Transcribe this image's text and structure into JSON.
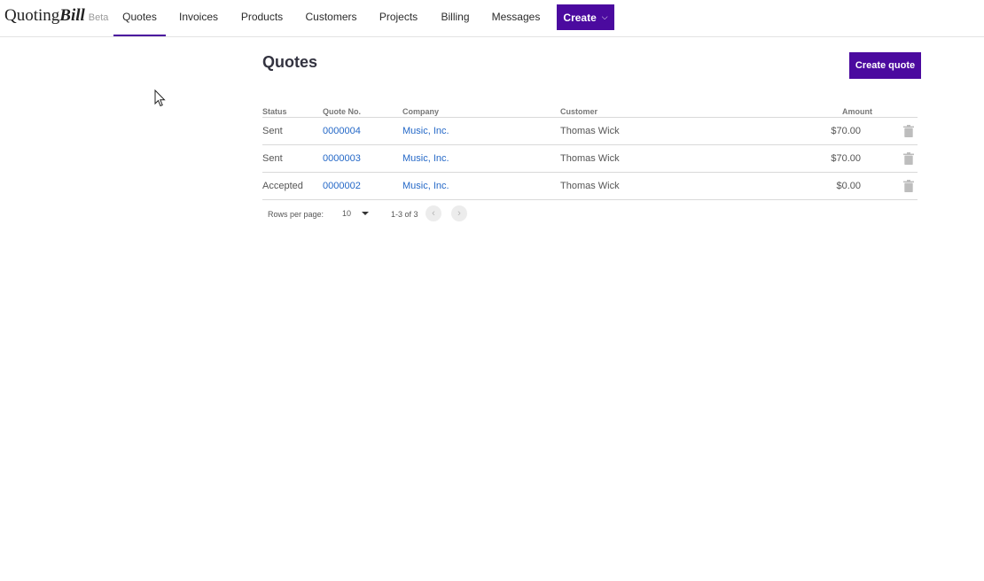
{
  "app": {
    "logo_word": "Quoting",
    "logo_bold": "Bill",
    "logo_badge": "Beta"
  },
  "nav": {
    "items": [
      {
        "label": "Quotes",
        "active": true
      },
      {
        "label": "Invoices"
      },
      {
        "label": "Products"
      },
      {
        "label": "Customers"
      },
      {
        "label": "Projects"
      },
      {
        "label": "Billing"
      },
      {
        "label": "Messages"
      }
    ],
    "create_label": "Create",
    "create_icon": "chevron-down-icon"
  },
  "page": {
    "title": "Quotes",
    "create_quote_label": "Create quote"
  },
  "table": {
    "headers": {
      "status": "Status",
      "quote_no": "Quote No.",
      "company": "Company",
      "customer": "Customer",
      "amount": "Amount"
    },
    "rows": [
      {
        "status": "Sent",
        "quote_no": "0000004",
        "company": "Music, Inc.",
        "customer": "Thomas Wick",
        "amount": "$70.00"
      },
      {
        "status": "Sent",
        "quote_no": "0000003",
        "company": "Music, Inc.",
        "customer": "Thomas Wick",
        "amount": "$70.00"
      },
      {
        "status": "Accepted",
        "quote_no": "0000002",
        "company": "Music, Inc.",
        "customer": "Thomas Wick",
        "amount": "$0.00"
      }
    ],
    "row_action_icon": "trash-icon"
  },
  "pagination": {
    "rows_per_page_label": "Rows per page:",
    "rows_per_page_value": "10",
    "range_text": "1-3 of 3",
    "prev_icon": "chevron-left-icon",
    "next_icon": "chevron-right-icon"
  },
  "colors": {
    "brand": "#4b0a9f",
    "link": "#2468c7"
  }
}
